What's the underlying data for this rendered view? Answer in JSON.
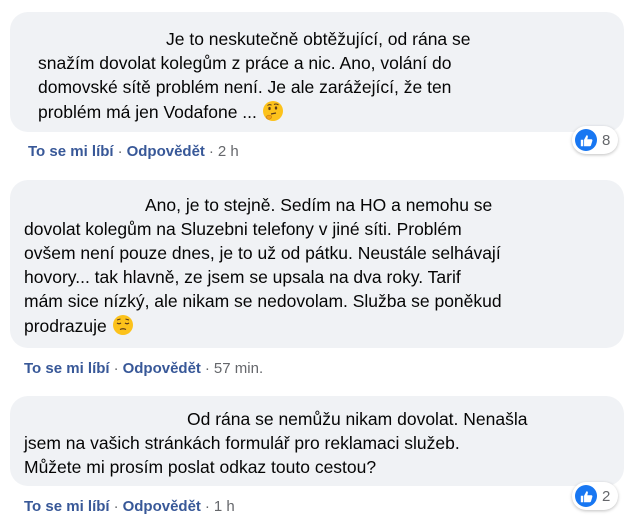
{
  "comments": [
    {
      "lines": [
        "Je to neskutečně obtěžující, od rána se",
        "snažím dovolat kolegům z práce a nic. Ano, volání do",
        "domovské sítě problém není. Je ale zarážející, že ten",
        "problém má jen Vodafone ..."
      ],
      "emoji": "thinking-face",
      "like": "To se mi líbí",
      "reply": "Odpovědět",
      "time": "2 h",
      "reactions": "8"
    },
    {
      "lines": [
        "Ano, je to stejně. Sedím na HO a nemohu se",
        "dovolat kolegům na Sluzebni telefony v jiné síti. Problém",
        "ovšem není pouze dnes, je to už od pátku. Neustále selhávají",
        "hovory... tak hlavně, ze jsem se upsala na dva roky. Tarif",
        "mám sice nízký, ale nikam se nedovolam. Služba se poněkud",
        "prodrazuje"
      ],
      "emoji": "pensive-face",
      "like": "To se mi líbí",
      "reply": "Odpovědět",
      "time": "57 min."
    },
    {
      "lines": [
        "Od rána se nemůžu nikam dovolat. Nenašla",
        "jsem na vašich stránkách formulář pro reklamaci služeb.",
        "Můžete mi prosím poslat odkaz touto cestou?"
      ],
      "like": "To se mi líbí",
      "reply": "Odpovědět",
      "time": "1 h",
      "reactions": "2"
    }
  ],
  "separator": "·",
  "colors": {
    "bubble": "#f0f2f5",
    "link": "#385898",
    "like_blue": "#1877f2",
    "meta": "#65676b"
  }
}
